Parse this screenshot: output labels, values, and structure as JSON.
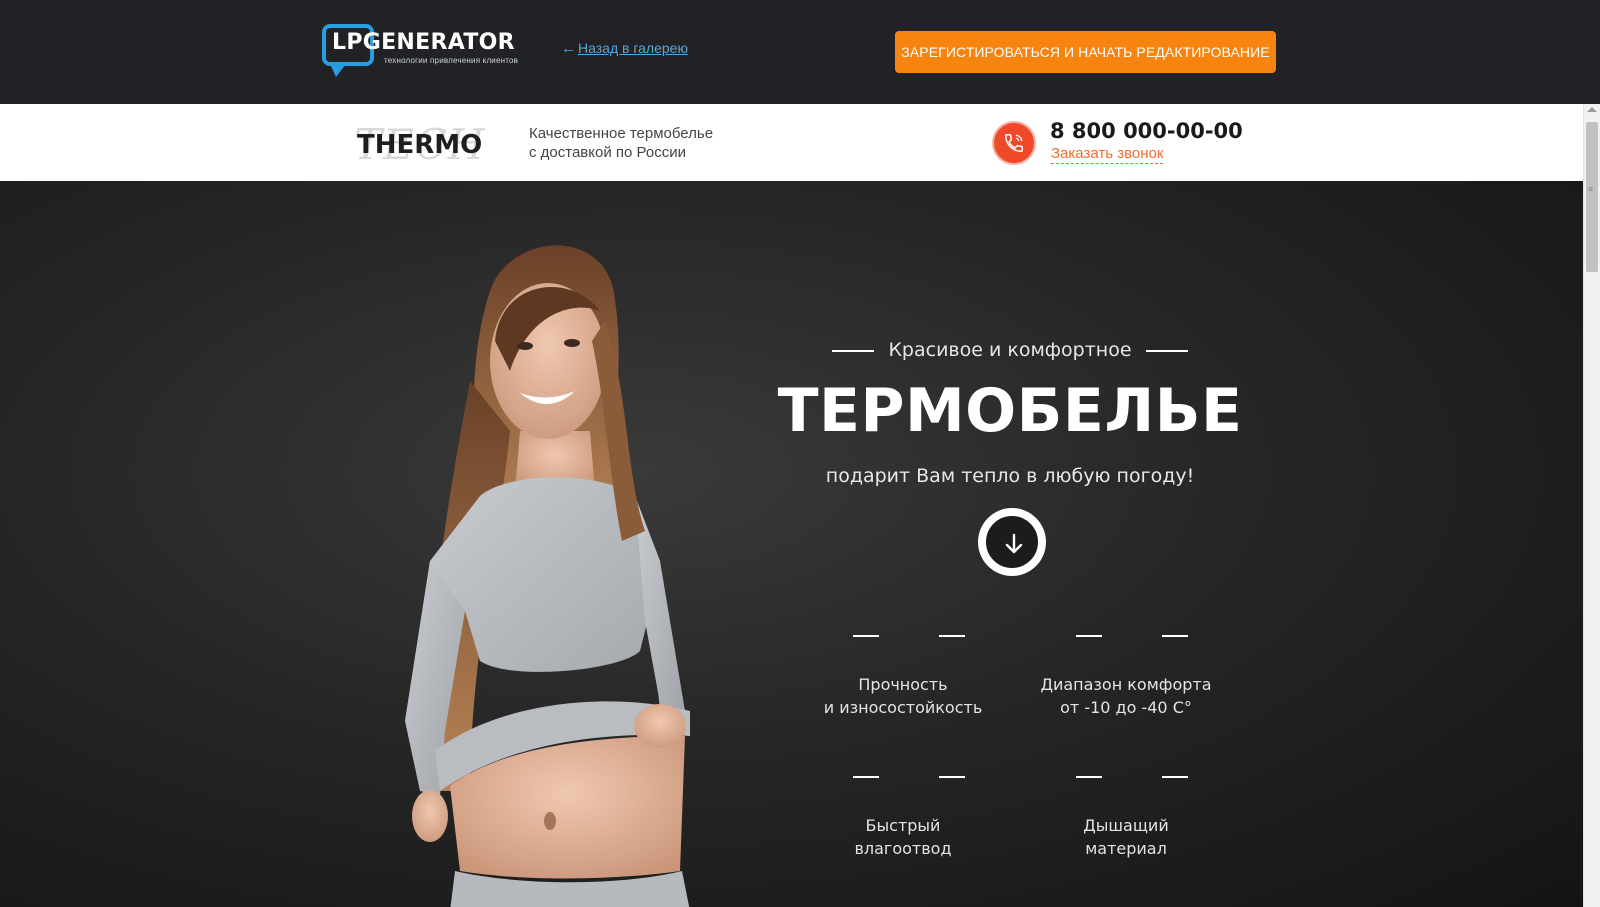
{
  "topbar": {
    "logo_name": "LPGENERATOR",
    "logo_tagline": "технологии привлечения клиентов",
    "back_link": "Назад в галерею",
    "cta_label": "Зарегистироваться и начать редактирование"
  },
  "header": {
    "brand_main": "THERMO",
    "brand_overlay": "TECH",
    "tagline_line1": "Качественное термобелье",
    "tagline_line2": "с доставкой по России",
    "phone": "8 800 000-00-00",
    "callback_link": "Заказать звонок"
  },
  "hero": {
    "kicker": "Красивое и комфортное",
    "title": "ТЕРМОБЕЛЬЕ",
    "subtitle": "подарит Вам тепло в любую погоду!",
    "features": [
      {
        "line1": "Прочность",
        "line2": "и износостойкость"
      },
      {
        "line1": "Диапазон комфорта",
        "line2": "от -10 до -40 С°"
      },
      {
        "line1": "Быстрый",
        "line2": "влагоотвод"
      },
      {
        "line1": "Дышащий",
        "line2": "материал"
      }
    ]
  },
  "colors": {
    "cta_orange": "#f7840e",
    "accent_red": "#ee4a2a",
    "link_blue": "#4fa8e8",
    "topbar_bg": "#212226"
  }
}
